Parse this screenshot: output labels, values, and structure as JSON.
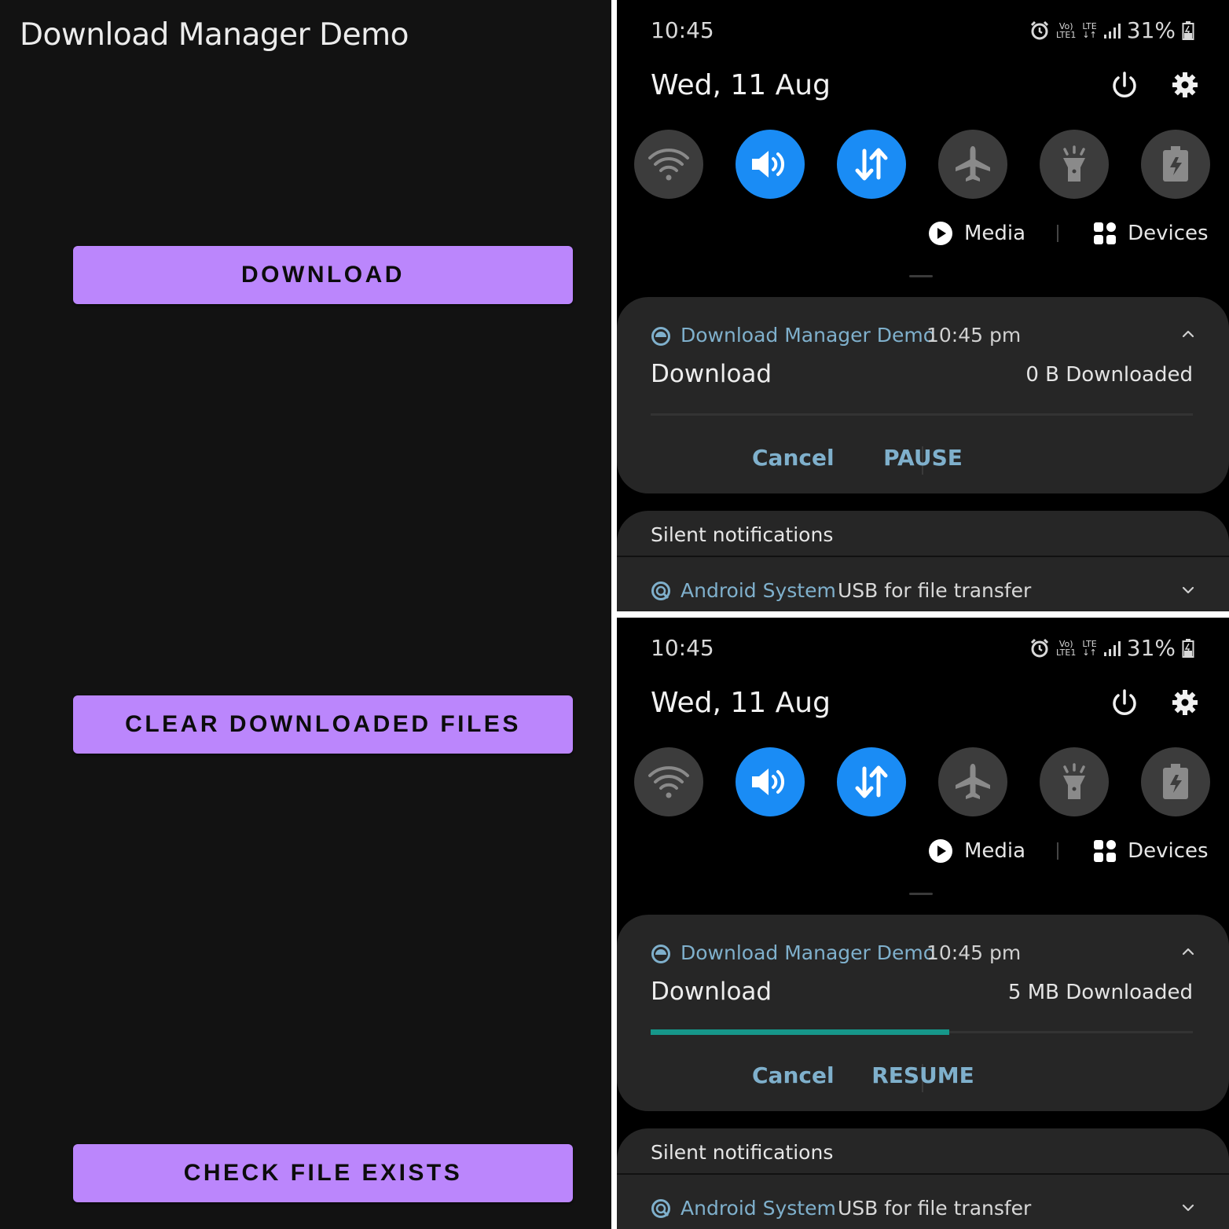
{
  "app": {
    "title": "Download Manager Demo",
    "buttons": {
      "download": "DOWNLOAD",
      "clear": "CLEAR DOWNLOADED FILES",
      "check": "CHECK FILE EXISTS"
    },
    "colors": {
      "background": "#121212",
      "button": "#bb86fc"
    }
  },
  "panels": [
    {
      "status": {
        "time": "10:45",
        "battery": "31%",
        "network_top": "Vo)",
        "network_bottom": "LTE1",
        "lte": "LTE"
      },
      "date": "Wed, 11 Aug",
      "quick_tiles": [
        "wifi-icon",
        "sound-icon",
        "mobile-data-icon",
        "airplane-icon",
        "flashlight-icon",
        "power-saving-icon"
      ],
      "media_label": "Media",
      "devices_label": "Devices",
      "notification": {
        "app_name": "Download Manager Demo",
        "time": "10:45 pm",
        "title": "Download",
        "status": "0 B Downloaded",
        "progress": 0,
        "cancel_label": "Cancel",
        "action_label": "PAUSE"
      },
      "silent": {
        "header": "Silent notifications",
        "app_name": "Android System",
        "text": "USB for file transfer"
      }
    },
    {
      "status": {
        "time": "10:45",
        "battery": "31%",
        "network_top": "Vo)",
        "network_bottom": "LTE1",
        "lte": "LTE"
      },
      "date": "Wed, 11 Aug",
      "quick_tiles": [
        "wifi-icon",
        "sound-icon",
        "mobile-data-icon",
        "airplane-icon",
        "flashlight-icon",
        "power-saving-icon"
      ],
      "media_label": "Media",
      "devices_label": "Devices",
      "notification": {
        "app_name": "Download Manager Demo",
        "time": "10:45 pm",
        "title": "Download",
        "status": "5 MB Downloaded",
        "progress": 0.55,
        "cancel_label": "Cancel",
        "action_label": "RESUME"
      },
      "silent": {
        "header": "Silent notifications",
        "app_name": "Android System",
        "text": "USB for file transfer"
      }
    }
  ],
  "colors": {
    "accent_tile": "#1a8cf5",
    "notif_accent": "#7fb0cc",
    "progress": "#16978a"
  }
}
